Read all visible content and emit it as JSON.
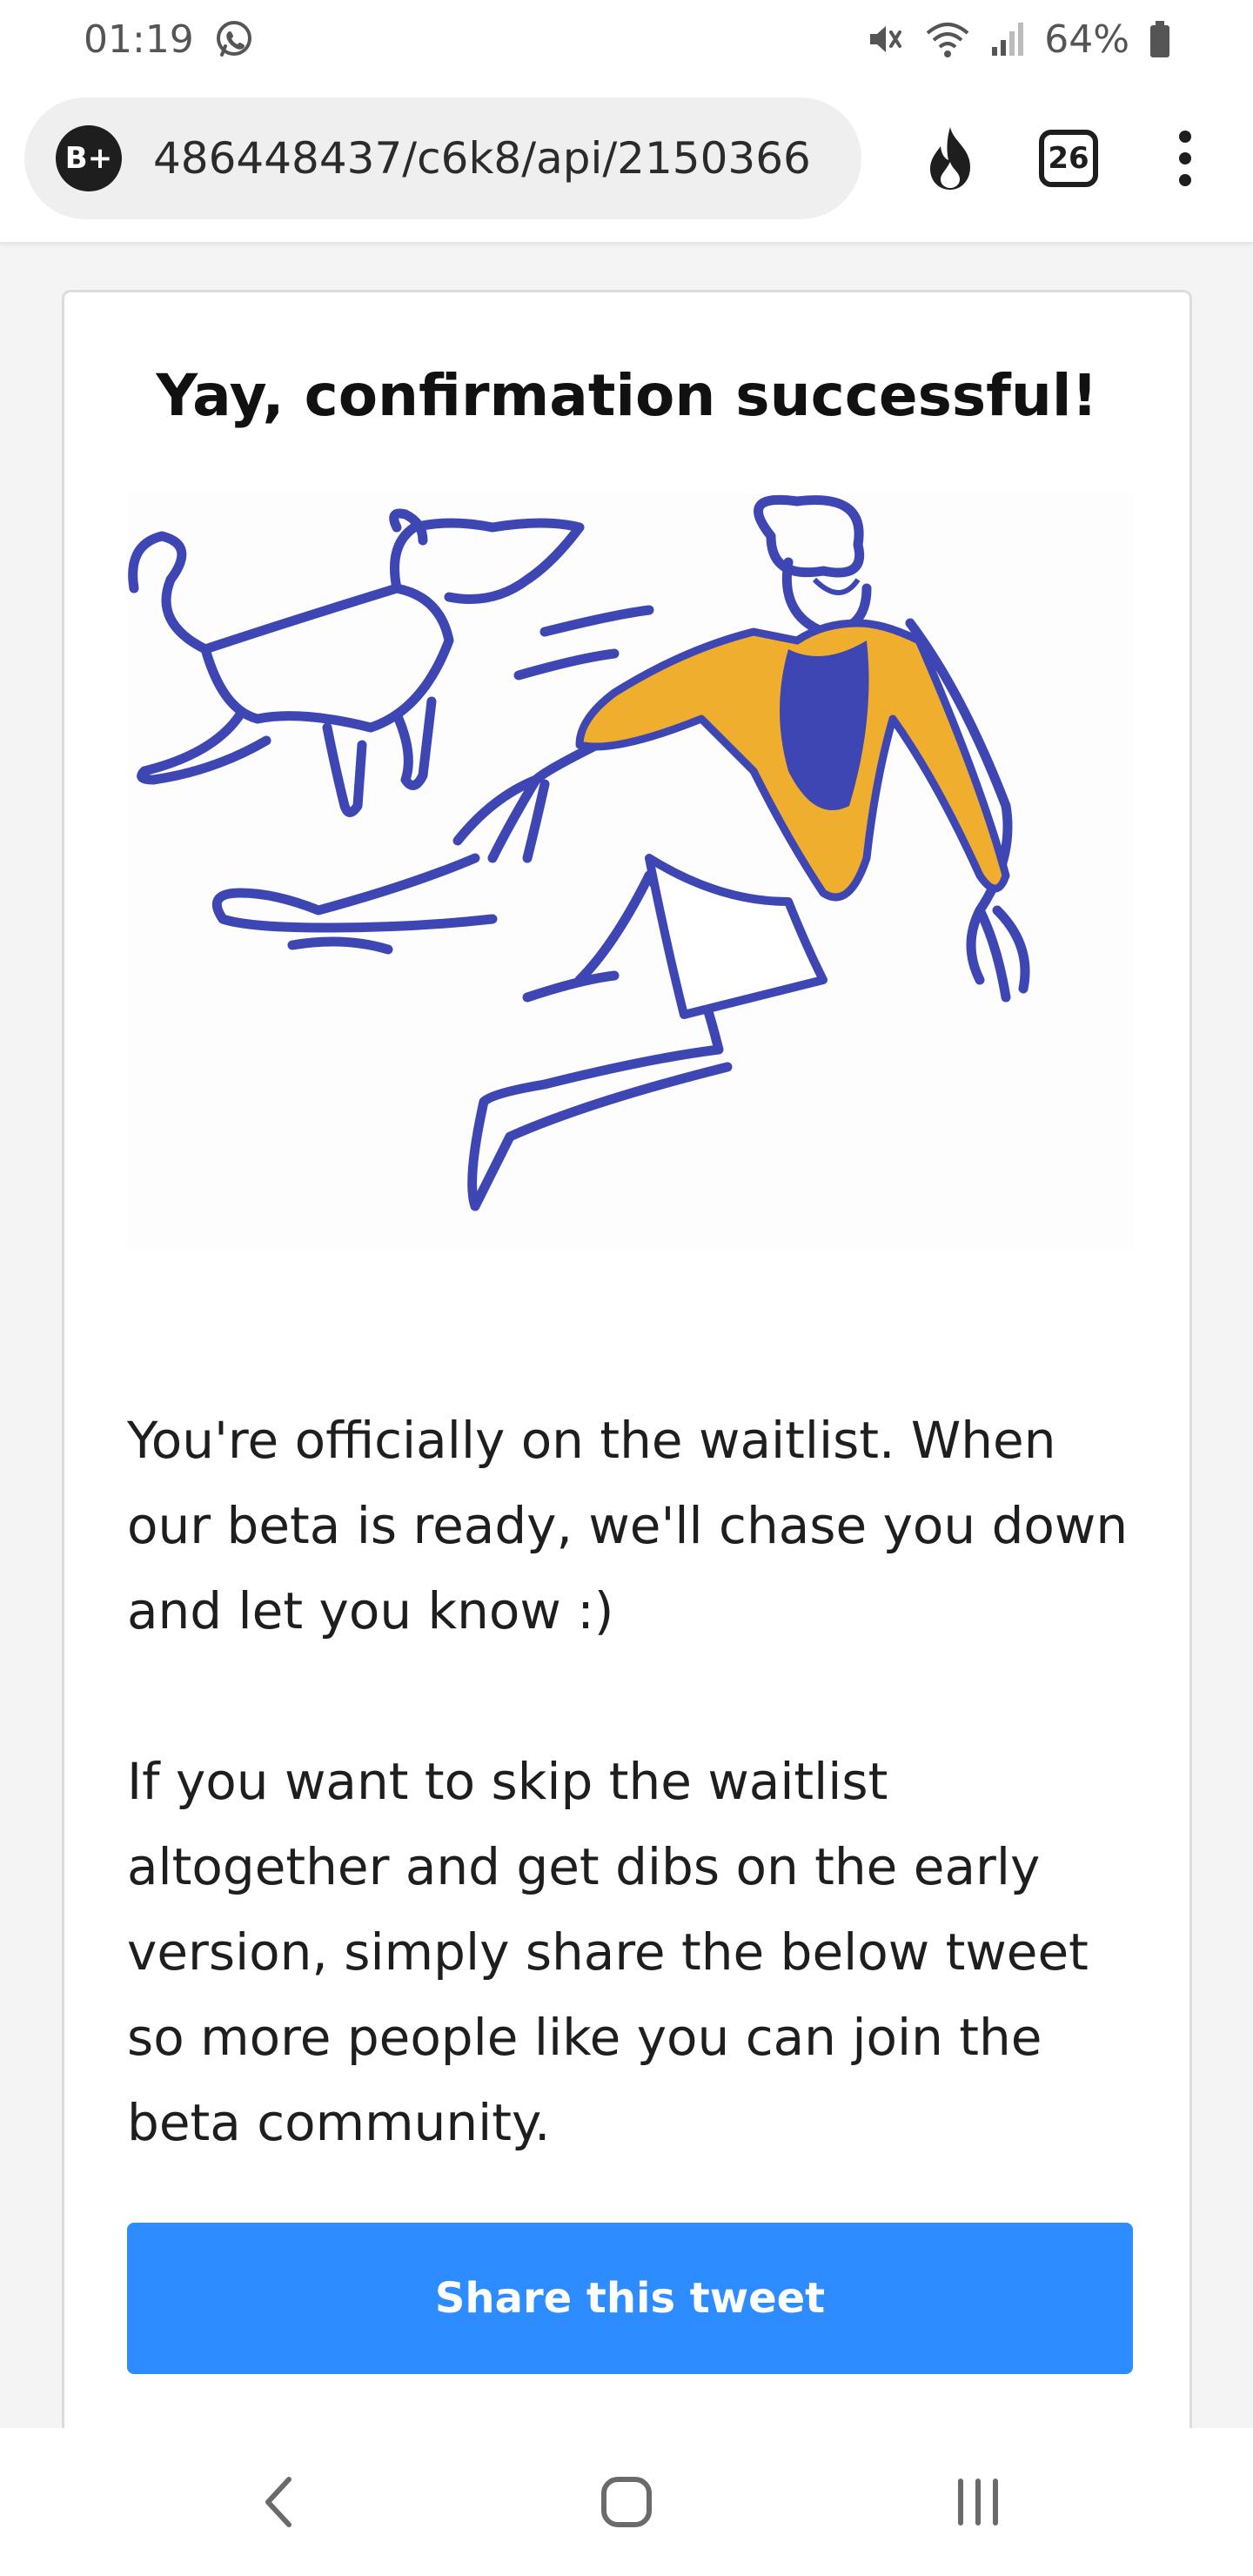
{
  "status_bar": {
    "time": "01:19",
    "battery": "64%",
    "icons": [
      "whatsapp-icon",
      "mute-icon",
      "wifi-icon",
      "signal-icon",
      "battery-icon"
    ]
  },
  "browser": {
    "site_badge": "B+",
    "url": "486448437/c6k8/api/2150366",
    "tab_count": "26",
    "icons": [
      "flame-icon",
      "tabs-icon",
      "more-vert-icon"
    ]
  },
  "card": {
    "title": "Yay, confirmation successful!",
    "illustration": {
      "icon": "person-and-dog-illustration",
      "colors": {
        "line": "#3e46b3",
        "jacket": "#f0ae2e"
      }
    },
    "paragraph_1": "You're officially on the waitlist. When our beta is ready, we'll chase you down and let you know :)",
    "paragraph_2": "If you want to skip the waitlist altogether and get dibs on the early version, simply share the below tweet so more people like you can join the beta community.",
    "share_button": "Share this tweet"
  },
  "nav_bar": {
    "icons": [
      "back-icon",
      "home-icon",
      "recents-icon"
    ]
  },
  "colors": {
    "accent": "#2d8cff",
    "background": "#f4f4f4",
    "card": "#ffffff"
  }
}
